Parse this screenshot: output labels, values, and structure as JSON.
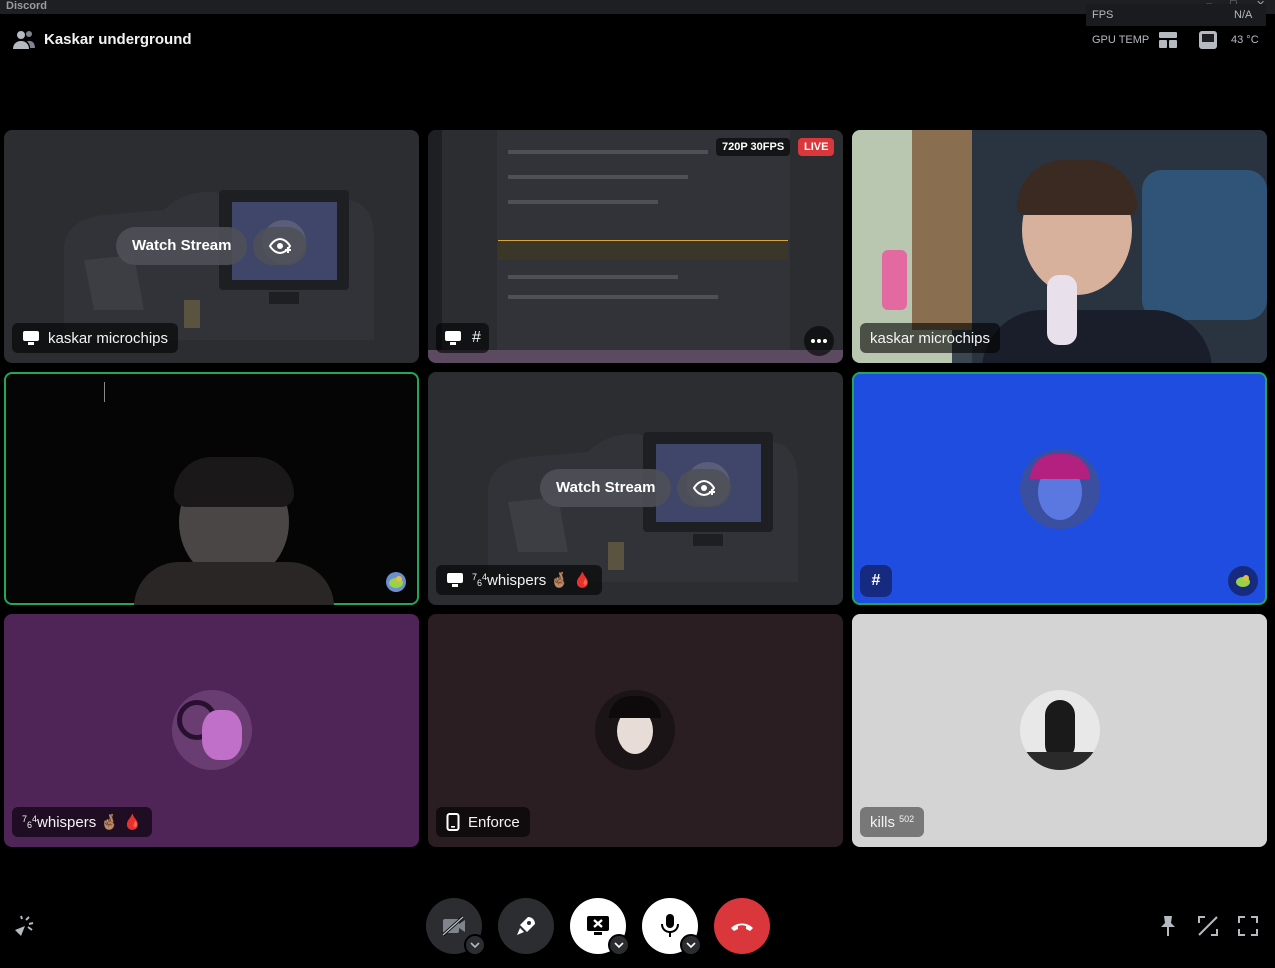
{
  "titlebar": {
    "app_name": "Discord"
  },
  "header": {
    "call_title": "Kaskar underground"
  },
  "overlay": {
    "fps_label": "FPS",
    "fps_value": "N/A",
    "gpu_label": "GPU TEMP",
    "gpu_value": "43 °C"
  },
  "tiles": [
    {
      "kind": "stream-preview",
      "name": "kaskar microchips",
      "watch_label": "Watch Stream",
      "icon": "screen-share-icon"
    },
    {
      "kind": "live-stream",
      "quality": "720P 30FPS",
      "live_label": "LIVE",
      "icons": [
        "screen-share-icon",
        "hash-icon",
        "more-icon"
      ]
    },
    {
      "kind": "camera",
      "name": "kaskar microchips"
    },
    {
      "kind": "camera",
      "speaking": true,
      "corner_icon": "avatar-badge-icon"
    },
    {
      "kind": "stream-preview",
      "name_sup": "7",
      "name_sup2": "6",
      "name_sup3": "4",
      "name": "whispers",
      "emoji": "🤞🏽 🩸",
      "watch_label": "Watch Stream",
      "icon": "screen-share-icon"
    },
    {
      "kind": "avatar",
      "speaking": true,
      "bg": "#1f4de0",
      "corner_left": "#",
      "corner_icon": "avatar-badge-icon"
    },
    {
      "kind": "avatar",
      "bg": "#4f2558",
      "name_sup": "7",
      "name_sup2": "6",
      "name_sup3": "4",
      "name": "whispers",
      "emoji": "🤞🏽 🩸"
    },
    {
      "kind": "avatar",
      "bg": "#2a1e23",
      "name": "Enforce",
      "icon": "mobile-icon"
    },
    {
      "kind": "avatar",
      "bg": "#d4d4d4",
      "name": "kills",
      "name_sup": "502"
    }
  ],
  "controls": {
    "camera": "camera-off-icon",
    "activities": "rocket-icon",
    "screen_share": "stop-share-icon",
    "microphone": "microphone-icon",
    "disconnect": "hang-up-icon",
    "colors": {
      "disconnect": "#da373c",
      "active": "#ffffff",
      "inactive": "#2b2d31"
    }
  }
}
